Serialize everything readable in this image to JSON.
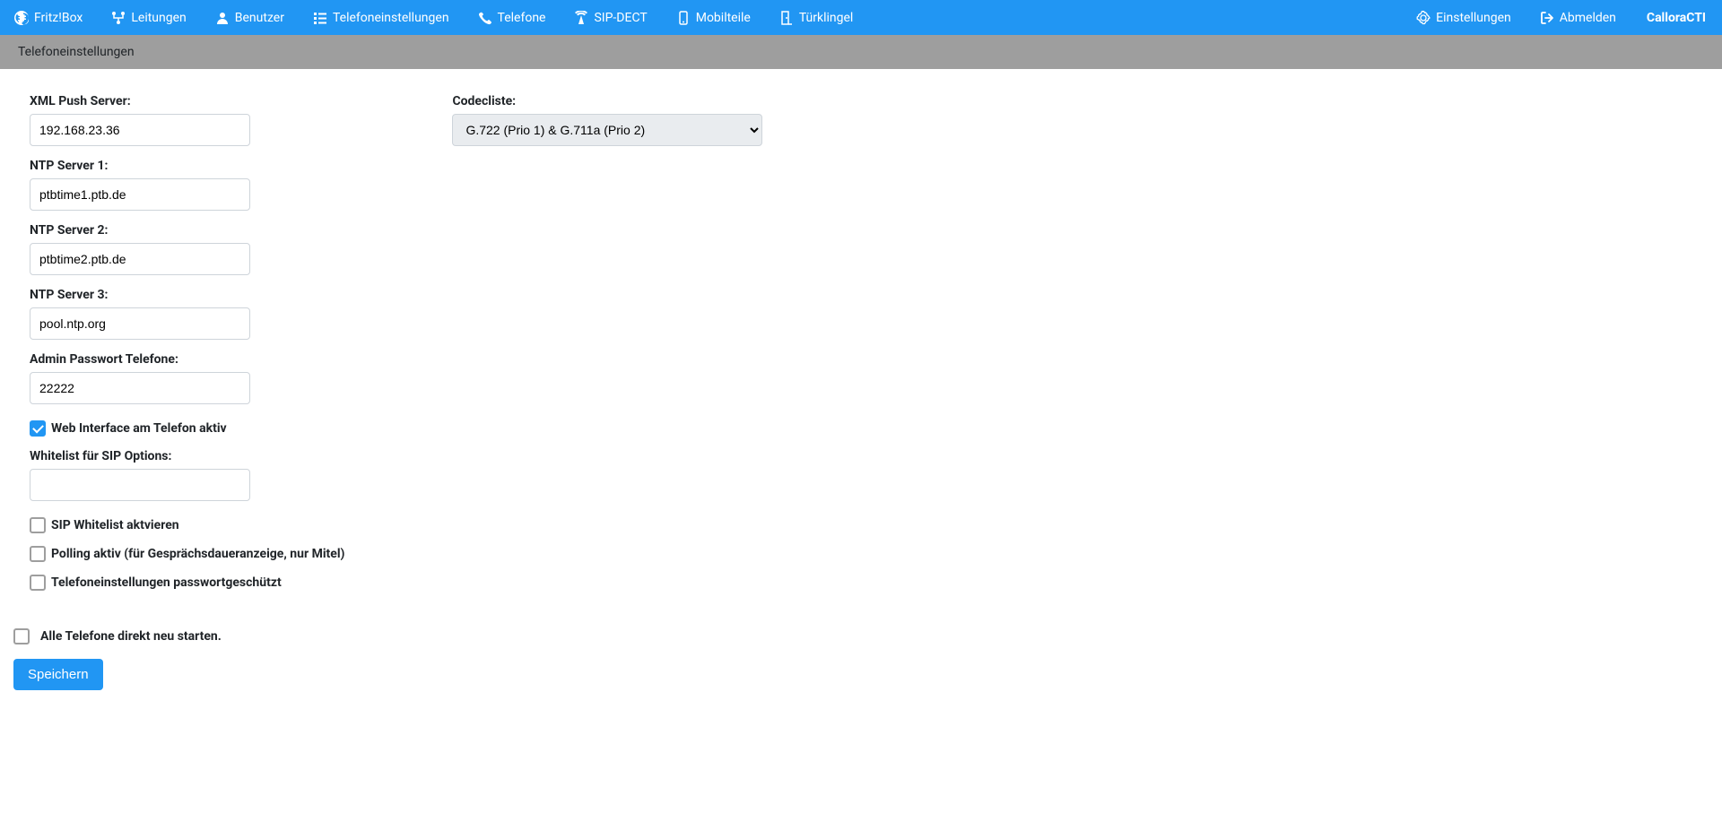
{
  "nav": {
    "items": [
      {
        "label": "Fritz!Box"
      },
      {
        "label": "Leitungen"
      },
      {
        "label": "Benutzer"
      },
      {
        "label": "Telefoneinstellungen"
      },
      {
        "label": "Telefone"
      },
      {
        "label": "SIP-DECT"
      },
      {
        "label": "Mobilteile"
      },
      {
        "label": "Türklingel"
      }
    ],
    "right": {
      "settings": "Einstellungen",
      "logout": "Abmelden",
      "brand": "CalloraCTI"
    }
  },
  "subheader": "Telefoneinstellungen",
  "form": {
    "xml_push_label": "XML Push Server:",
    "xml_push_value": "192.168.23.36",
    "ntp1_label": "NTP Server 1:",
    "ntp1_value": "ptbtime1.ptb.de",
    "ntp2_label": "NTP Server 2:",
    "ntp2_value": "ptbtime2.ptb.de",
    "ntp3_label": "NTP Server 3:",
    "ntp3_value": "pool.ntp.org",
    "admin_pw_label": "Admin Passwort Telefone:",
    "admin_pw_value": "22222",
    "web_if_label": "Web Interface am Telefon aktiv",
    "whitelist_label": "Whitelist für SIP Options:",
    "whitelist_value": "",
    "sip_wl_label": "SIP Whitelist aktvieren",
    "polling_label": "Polling aktiv (für Gesprächsdaueranzeige, nur Mitel)",
    "pw_protect_label": "Telefoneinstellungen passwortgeschützt",
    "codec_label": "Codecliste:",
    "codec_selected": "G.722 (Prio 1) & G.711a (Prio 2)"
  },
  "actions": {
    "restart_all_label": "Alle Telefone direkt neu starten.",
    "save": "Speichern"
  }
}
